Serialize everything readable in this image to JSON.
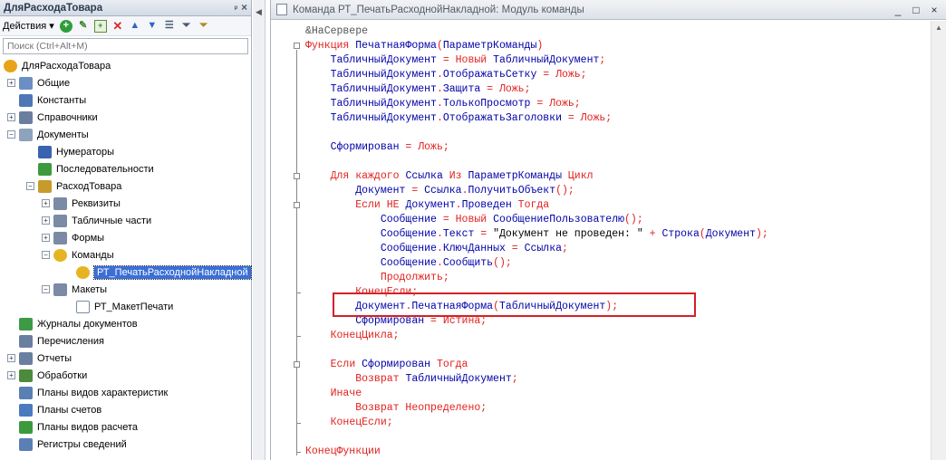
{
  "left_panel": {
    "title": "ДляРасходаТовара",
    "pin_glyph": "ᵖ",
    "close_glyph": "×",
    "actions_label": "Действия ▾",
    "search_placeholder": "Поиск (Ctrl+Alt+M)",
    "toolbar_icons": [
      "add-icon",
      "edit-icon",
      "copy-icon",
      "delete-icon",
      "move-up-icon",
      "move-down-icon",
      "list-icon",
      "filter-icon",
      "clear-filter-icon"
    ],
    "tree": [
      {
        "label": "ДляРасходаТовара",
        "level": 0,
        "expander": "",
        "icon": "config-icon"
      },
      {
        "label": "Общие",
        "level": 1,
        "expander": "+",
        "icon": "common-icon"
      },
      {
        "label": "Константы",
        "level": 1,
        "expander": "",
        "icon": "constants-icon"
      },
      {
        "label": "Справочники",
        "level": 1,
        "expander": "+",
        "icon": "catalogs-icon"
      },
      {
        "label": "Документы",
        "level": 1,
        "expander": "−",
        "icon": "documents-icon"
      },
      {
        "label": "Нумераторы",
        "level": 2,
        "expander": "",
        "icon": "numerators-icon"
      },
      {
        "label": "Последовательности",
        "level": 2,
        "expander": "",
        "icon": "sequences-icon"
      },
      {
        "label": "РасходТовара",
        "level": 2,
        "expander": "−",
        "icon": "document-icon"
      },
      {
        "label": "Реквизиты",
        "level": 3,
        "expander": "+",
        "icon": "attributes-icon"
      },
      {
        "label": "Табличные части",
        "level": 3,
        "expander": "+",
        "icon": "tabular-icon"
      },
      {
        "label": "Формы",
        "level": 3,
        "expander": "+",
        "icon": "forms-icon"
      },
      {
        "label": "Команды",
        "level": 3,
        "expander": "−",
        "icon": "commands-icon"
      },
      {
        "label": "РТ_ПечатьРасходнойНакладной",
        "level": 4,
        "expander": "",
        "icon": "command-icon",
        "selected": true
      },
      {
        "label": "Макеты",
        "level": 3,
        "expander": "−",
        "icon": "templates-icon"
      },
      {
        "label": "РТ_МакетПечати",
        "level": 4,
        "expander": "",
        "icon": "template-icon"
      },
      {
        "label": "Журналы документов",
        "level": 1,
        "expander": "",
        "icon": "journals-icon"
      },
      {
        "label": "Перечисления",
        "level": 1,
        "expander": "",
        "icon": "enums-icon"
      },
      {
        "label": "Отчеты",
        "level": 1,
        "expander": "+",
        "icon": "reports-icon"
      },
      {
        "label": "Обработки",
        "level": 1,
        "expander": "+",
        "icon": "dataprocessors-icon"
      },
      {
        "label": "Планы видов характеристик",
        "level": 1,
        "expander": "",
        "icon": "chart-of-characteristics-icon"
      },
      {
        "label": "Планы счетов",
        "level": 1,
        "expander": "",
        "icon": "chart-of-accounts-icon"
      },
      {
        "label": "Планы видов расчета",
        "level": 1,
        "expander": "",
        "icon": "chart-of-calculation-icon"
      },
      {
        "label": "Регистры сведений",
        "level": 1,
        "expander": "",
        "icon": "information-registers-icon"
      }
    ]
  },
  "editor": {
    "title": "Команда РТ_ПечатьРасходнойНакладной: Модуль команды",
    "window_buttons": [
      "_",
      "□",
      "×"
    ],
    "code": [
      [
        [
          "dir",
          "&НаСервере"
        ]
      ],
      [
        [
          "kw",
          "Функция "
        ],
        [
          "id",
          "ПечатнаяФорма"
        ],
        [
          "kw",
          "("
        ],
        [
          "id",
          "ПараметрКоманды"
        ],
        [
          "kw",
          ")"
        ]
      ],
      [
        [
          "st",
          "    "
        ],
        [
          "id",
          "ТабличныйДокумент"
        ],
        [
          "kw",
          " = Новый "
        ],
        [
          "id",
          "ТабличныйДокумент"
        ],
        [
          "kw",
          ";"
        ]
      ],
      [
        [
          "st",
          "    "
        ],
        [
          "id",
          "ТабличныйДокумент"
        ],
        [
          "kw",
          "."
        ],
        [
          "id",
          "ОтображатьСетку"
        ],
        [
          "kw",
          " = Ложь;"
        ]
      ],
      [
        [
          "st",
          "    "
        ],
        [
          "id",
          "ТабличныйДокумент"
        ],
        [
          "kw",
          "."
        ],
        [
          "id",
          "Защита"
        ],
        [
          "kw",
          " = Ложь;"
        ]
      ],
      [
        [
          "st",
          "    "
        ],
        [
          "id",
          "ТабличныйДокумент"
        ],
        [
          "kw",
          "."
        ],
        [
          "id",
          "ТолькоПросмотр"
        ],
        [
          "kw",
          " = Ложь;"
        ]
      ],
      [
        [
          "st",
          "    "
        ],
        [
          "id",
          "ТабличныйДокумент"
        ],
        [
          "kw",
          "."
        ],
        [
          "id",
          "ОтображатьЗаголовки"
        ],
        [
          "kw",
          " = Ложь;"
        ]
      ],
      [],
      [
        [
          "st",
          "    "
        ],
        [
          "id",
          "Сформирован"
        ],
        [
          "kw",
          " = Ложь;"
        ]
      ],
      [],
      [
        [
          "st",
          "    "
        ],
        [
          "kw",
          "Для каждого "
        ],
        [
          "id",
          "Ссылка"
        ],
        [
          "kw",
          " Из "
        ],
        [
          "id",
          "ПараметрКоманды"
        ],
        [
          "kw",
          " Цикл"
        ]
      ],
      [
        [
          "st",
          "        "
        ],
        [
          "id",
          "Документ"
        ],
        [
          "kw",
          " = "
        ],
        [
          "id",
          "Ссылка"
        ],
        [
          "kw",
          "."
        ],
        [
          "id",
          "ПолучитьОбъект"
        ],
        [
          "kw",
          "();"
        ]
      ],
      [
        [
          "st",
          "        "
        ],
        [
          "kw",
          "Если НЕ "
        ],
        [
          "id",
          "Документ"
        ],
        [
          "kw",
          "."
        ],
        [
          "id",
          "Проведен"
        ],
        [
          "kw",
          " Тогда"
        ]
      ],
      [
        [
          "st",
          "            "
        ],
        [
          "id",
          "Сообщение"
        ],
        [
          "kw",
          " = Новый "
        ],
        [
          "id",
          "СообщениеПользователю"
        ],
        [
          "kw",
          "();"
        ]
      ],
      [
        [
          "st",
          "            "
        ],
        [
          "id",
          "Сообщение"
        ],
        [
          "kw",
          "."
        ],
        [
          "id",
          "Текст"
        ],
        [
          "kw",
          " = "
        ],
        [
          "st",
          "\"Документ не проведен: \""
        ],
        [
          "kw",
          " + "
        ],
        [
          "id",
          "Строка"
        ],
        [
          "kw",
          "("
        ],
        [
          "id",
          "Документ"
        ],
        [
          "kw",
          ");"
        ]
      ],
      [
        [
          "st",
          "            "
        ],
        [
          "id",
          "Сообщение"
        ],
        [
          "kw",
          "."
        ],
        [
          "id",
          "КлючДанных"
        ],
        [
          "kw",
          " = "
        ],
        [
          "id",
          "Ссылка"
        ],
        [
          "kw",
          ";"
        ]
      ],
      [
        [
          "st",
          "            "
        ],
        [
          "id",
          "Сообщение"
        ],
        [
          "kw",
          "."
        ],
        [
          "id",
          "Сообщить"
        ],
        [
          "kw",
          "();"
        ]
      ],
      [
        [
          "st",
          "            "
        ],
        [
          "kw",
          "Продолжить;"
        ]
      ],
      [
        [
          "st",
          "        "
        ],
        [
          "kw",
          "КонецЕсли;"
        ]
      ],
      [
        [
          "st",
          "        "
        ],
        [
          "id",
          "Документ"
        ],
        [
          "kw",
          "."
        ],
        [
          "id",
          "ПечатнаяФорма"
        ],
        [
          "kw",
          "("
        ],
        [
          "id",
          "ТабличныйДокумент"
        ],
        [
          "kw",
          ");"
        ]
      ],
      [
        [
          "st",
          "        "
        ],
        [
          "id",
          "Сформирован"
        ],
        [
          "kw",
          " = Истина;"
        ]
      ],
      [
        [
          "st",
          "    "
        ],
        [
          "kw",
          "КонецЦикла;"
        ]
      ],
      [],
      [
        [
          "st",
          "    "
        ],
        [
          "kw",
          "Если "
        ],
        [
          "id",
          "Сформирован"
        ],
        [
          "kw",
          " Тогда"
        ]
      ],
      [
        [
          "st",
          "        "
        ],
        [
          "kw",
          "Возврат "
        ],
        [
          "id",
          "ТабличныйДокумент"
        ],
        [
          "kw",
          ";"
        ]
      ],
      [
        [
          "st",
          "    "
        ],
        [
          "kw",
          "Иначе"
        ]
      ],
      [
        [
          "st",
          "        "
        ],
        [
          "kw",
          "Возврат Неопределено;"
        ]
      ],
      [
        [
          "st",
          "    "
        ],
        [
          "kw",
          "КонецЕсли;"
        ]
      ],
      [],
      [
        [
          "kw",
          "КонецФункции"
        ]
      ]
    ]
  },
  "colors": {
    "keyword": "#e0221f",
    "identifier": "#0000a8",
    "highlight_box": "#d32028",
    "selection": "#3b6fd6"
  }
}
